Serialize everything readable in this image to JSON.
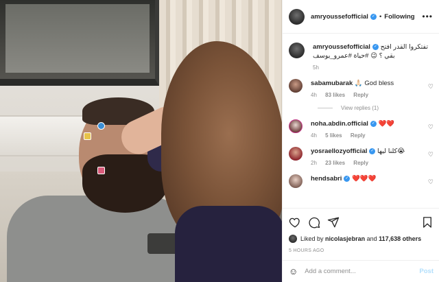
{
  "header": {
    "username": "amryoussefofficial",
    "separator": "•",
    "follow_status": "Following",
    "more_label": "•••"
  },
  "caption": {
    "username": "amryoussefofficial",
    "text": "تفتكروا القدر افتح بقي ؟ 😉 #حياة #عمرو_يوسف",
    "time": "5h"
  },
  "comments": [
    {
      "username": "sabamubarak",
      "text": "🙏🏻 God bless",
      "time": "4h",
      "likes": "83 likes",
      "reply": "Reply"
    },
    {
      "username": "noha.abdin.official",
      "text": "❤️❤️",
      "time": "4h",
      "likes": "5 likes",
      "reply": "Reply"
    },
    {
      "username": "yosraellozyofficial",
      "text": "كلنا ليها😭",
      "time": "2h",
      "likes": "23 likes",
      "reply": "Reply"
    },
    {
      "username": "hendsabri",
      "text": "❤️❤️❤️"
    }
  ],
  "view_replies": "View replies (1)",
  "likes": {
    "prefix": "Liked by",
    "user": "nicolasjebran",
    "and": "and",
    "count": "117,638 others"
  },
  "posted_time": "5 HOURS AGO",
  "add_comment": {
    "placeholder": "Add a comment...",
    "post_label": "Post"
  },
  "colors": {
    "verified": "#3897f0",
    "post_disabled": "#b2dffc",
    "muted": "#8e8e8e"
  },
  "icons": [
    "heart-icon",
    "comment-icon",
    "share-icon",
    "save-icon",
    "emoji-icon",
    "verified-icon"
  ]
}
